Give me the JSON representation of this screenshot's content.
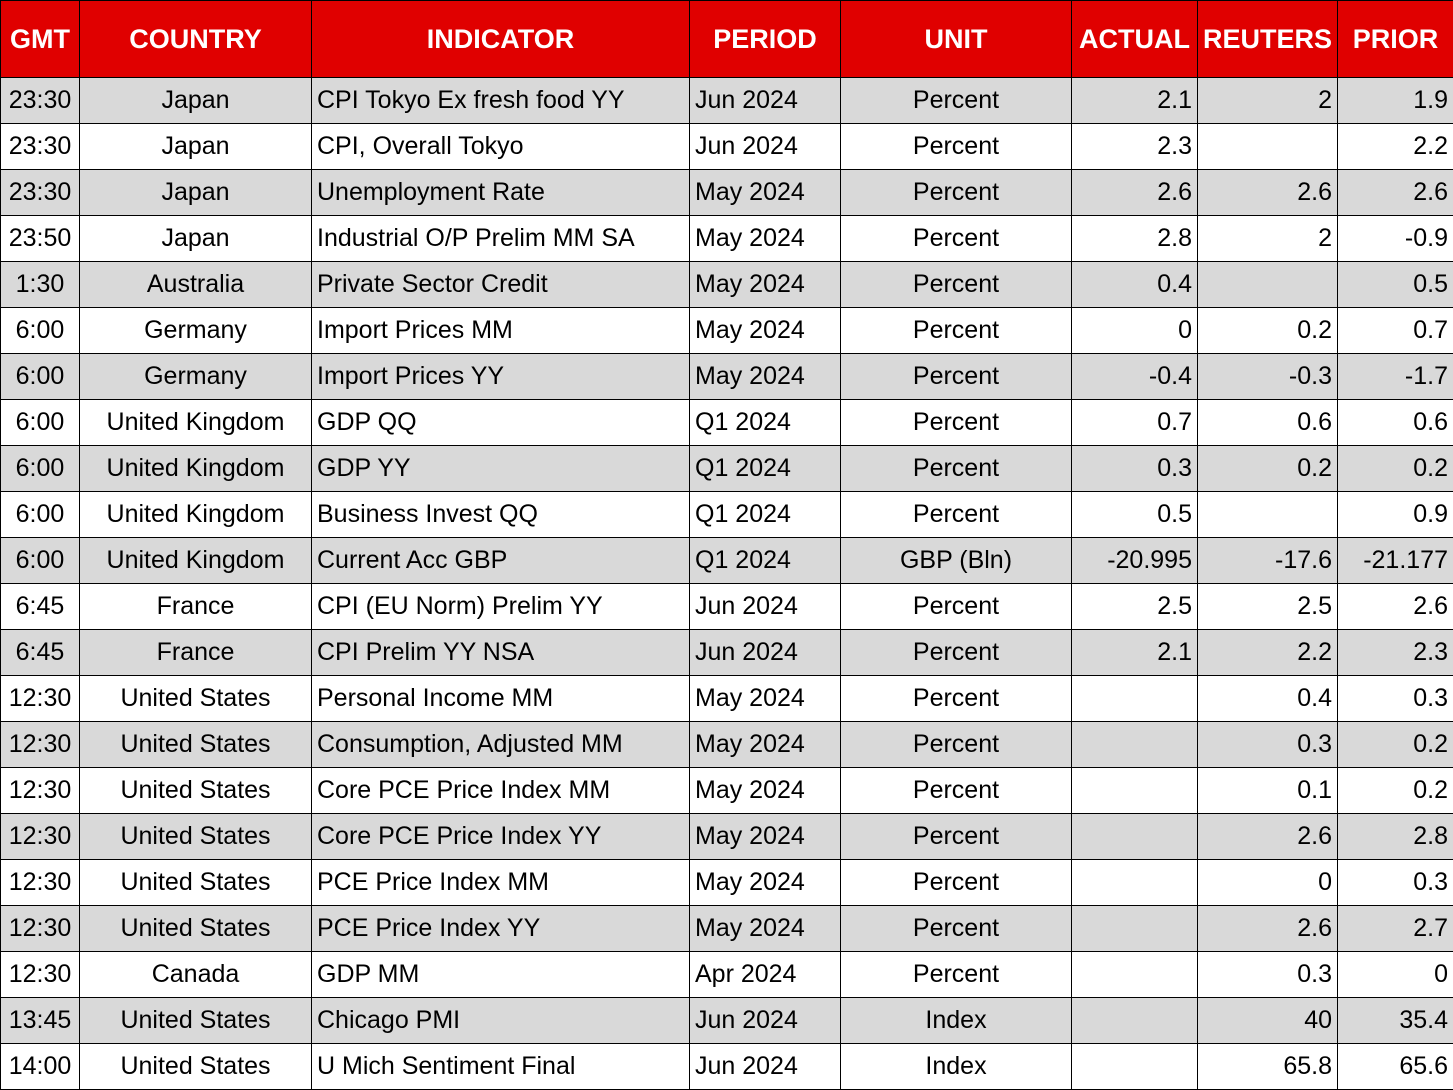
{
  "colors": {
    "header_bg": "#e00000",
    "header_text": "#ffffff",
    "stripe": "#d9d9d9"
  },
  "headers": [
    "GMT",
    "COUNTRY",
    "INDICATOR",
    "PERIOD",
    "UNIT",
    "ACTUAL",
    "REUTERS POLL",
    "PRIOR"
  ],
  "rows": [
    [
      "23:30",
      "Japan",
      "CPI Tokyo Ex fresh food YY",
      "Jun 2024",
      "Percent",
      "2.1",
      "2",
      "1.9"
    ],
    [
      "23:30",
      "Japan",
      "CPI, Overall Tokyo",
      "Jun 2024",
      "Percent",
      "2.3",
      "",
      "2.2"
    ],
    [
      "23:30",
      "Japan",
      "Unemployment Rate",
      "May 2024",
      "Percent",
      "2.6",
      "2.6",
      "2.6"
    ],
    [
      "23:50",
      "Japan",
      "Industrial O/P Prelim MM SA",
      "May 2024",
      "Percent",
      "2.8",
      "2",
      "-0.9"
    ],
    [
      "1:30",
      "Australia",
      "Private Sector Credit",
      "May 2024",
      "Percent",
      "0.4",
      "",
      "0.5"
    ],
    [
      "6:00",
      "Germany",
      "Import Prices MM",
      "May 2024",
      "Percent",
      "0",
      "0.2",
      "0.7"
    ],
    [
      "6:00",
      "Germany",
      "Import Prices YY",
      "May 2024",
      "Percent",
      "-0.4",
      "-0.3",
      "-1.7"
    ],
    [
      "6:00",
      "United Kingdom",
      "GDP QQ",
      "Q1 2024",
      "Percent",
      "0.7",
      "0.6",
      "0.6"
    ],
    [
      "6:00",
      "United Kingdom",
      "GDP YY",
      "Q1 2024",
      "Percent",
      "0.3",
      "0.2",
      "0.2"
    ],
    [
      "6:00",
      "United Kingdom",
      "Business Invest QQ",
      "Q1 2024",
      "Percent",
      "0.5",
      "",
      "0.9"
    ],
    [
      "6:00",
      "United Kingdom",
      "Current Acc GBP",
      "Q1 2024",
      "GBP (Bln)",
      "-20.995",
      "-17.6",
      "-21.177"
    ],
    [
      "6:45",
      "France",
      "CPI (EU Norm) Prelim YY",
      "Jun 2024",
      "Percent",
      "2.5",
      "2.5",
      "2.6"
    ],
    [
      "6:45",
      "France",
      "CPI Prelim YY NSA",
      "Jun 2024",
      "Percent",
      "2.1",
      "2.2",
      "2.3"
    ],
    [
      "12:30",
      "United States",
      "Personal Income MM",
      "May 2024",
      "Percent",
      "",
      "0.4",
      "0.3"
    ],
    [
      "12:30",
      "United States",
      "Consumption, Adjusted MM",
      "May 2024",
      "Percent",
      "",
      "0.3",
      "0.2"
    ],
    [
      "12:30",
      "United States",
      "Core PCE Price Index MM",
      "May 2024",
      "Percent",
      "",
      "0.1",
      "0.2"
    ],
    [
      "12:30",
      "United States",
      "Core PCE Price Index YY",
      "May 2024",
      "Percent",
      "",
      "2.6",
      "2.8"
    ],
    [
      "12:30",
      "United States",
      "PCE Price Index MM",
      "May 2024",
      "Percent",
      "",
      "0",
      "0.3"
    ],
    [
      "12:30",
      "United States",
      "PCE Price Index YY",
      "May 2024",
      "Percent",
      "",
      "2.6",
      "2.7"
    ],
    [
      "12:30",
      "Canada",
      "GDP MM",
      "Apr 2024",
      "Percent",
      "",
      "0.3",
      "0"
    ],
    [
      "13:45",
      "United States",
      "Chicago PMI",
      "Jun 2024",
      "Index",
      "",
      "40",
      "35.4"
    ],
    [
      "14:00",
      "United States",
      "U Mich Sentiment Final",
      "Jun 2024",
      "Index",
      "",
      "65.8",
      "65.6"
    ]
  ]
}
